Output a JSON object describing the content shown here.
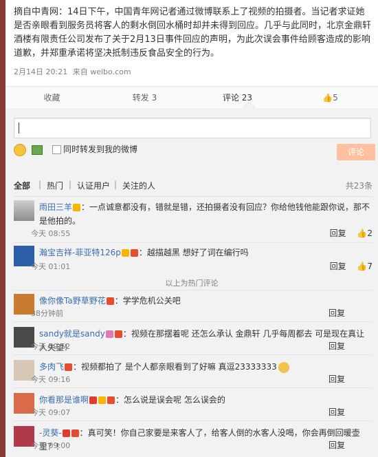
{
  "post": {
    "text": "摘自中青网：14日下午，中国青年网记者通过微博联系上了视频的拍摄者。当记者求证她是否亲眼看到服务员将客人的剩水倒回水桶时却并未得到回应。几乎与此同时，北京金鼎轩酒楼有限责任公司发布了关于2月13日事件回应的声明，为此次误会事件给顾客造成的影响道歉，并郑重承诺将坚决抵制违反食品安全的行为。",
    "time": "2月14日 20:21",
    "source": "来自 weibo.com"
  },
  "actions": {
    "favorite": "收藏",
    "repost": "转发 3",
    "comment": "评论 23",
    "like": "5"
  },
  "compose": {
    "forward_label": "同时转发到我的微博",
    "submit_label": "评论"
  },
  "filters": {
    "all": "全部",
    "hot": "热门",
    "verified": "认证用户",
    "following": "关注的人",
    "total": "共23条"
  },
  "hot_note": "以上为热门评论",
  "comments": [
    {
      "user": "雨田三羊",
      "text": "：一点诚意都没有，错就是错，还拍摄者没有回应？你给他钱他能跟你说，那不是他拍的。",
      "time": "今天 08:55",
      "reply": "回复",
      "likes": "2"
    },
    {
      "user": "瀚宝吉祥-菲亚特126p",
      "text": "：越描越黑 想好了词在编行吗",
      "time": "今天 01:01",
      "reply": "回复",
      "likes": "7"
    },
    {
      "user": "像你像Ta野草野花",
      "text": "：学学危机公关吧",
      "time": "38分钟前",
      "reply": "回复",
      "likes": ""
    },
    {
      "user": "sandy就是sandy",
      "text": "：视频在那摆着呢 还怎么承认 金鼎轩 几乎每周都去 可是现在真让人失望！",
      "time": "今天 09:52",
      "reply": "回复",
      "likes": ""
    },
    {
      "user": "多肉飞",
      "text": "：视频都拍了 是个人都亲眼看到了好嘛 真逗23333333",
      "time": "今天 09:16",
      "reply": "回复",
      "likes": ""
    },
    {
      "user": "你看那是谁啊",
      "text": "：怎么说是误会呢 怎么误会的",
      "time": "今天 09:07",
      "reply": "回复",
      "likes": ""
    },
    {
      "user": "-灵葵-",
      "text": "：真可笑！你自己家要是来客人了，给客人倒的水客人没喝，你会再倒回暖壶里？！",
      "time": "今天 09:00",
      "reply": "回复",
      "likes": ""
    }
  ],
  "colors": {
    "link": "#3a6db1",
    "submit": "#ffc09f",
    "frame": "#8a3a36"
  }
}
